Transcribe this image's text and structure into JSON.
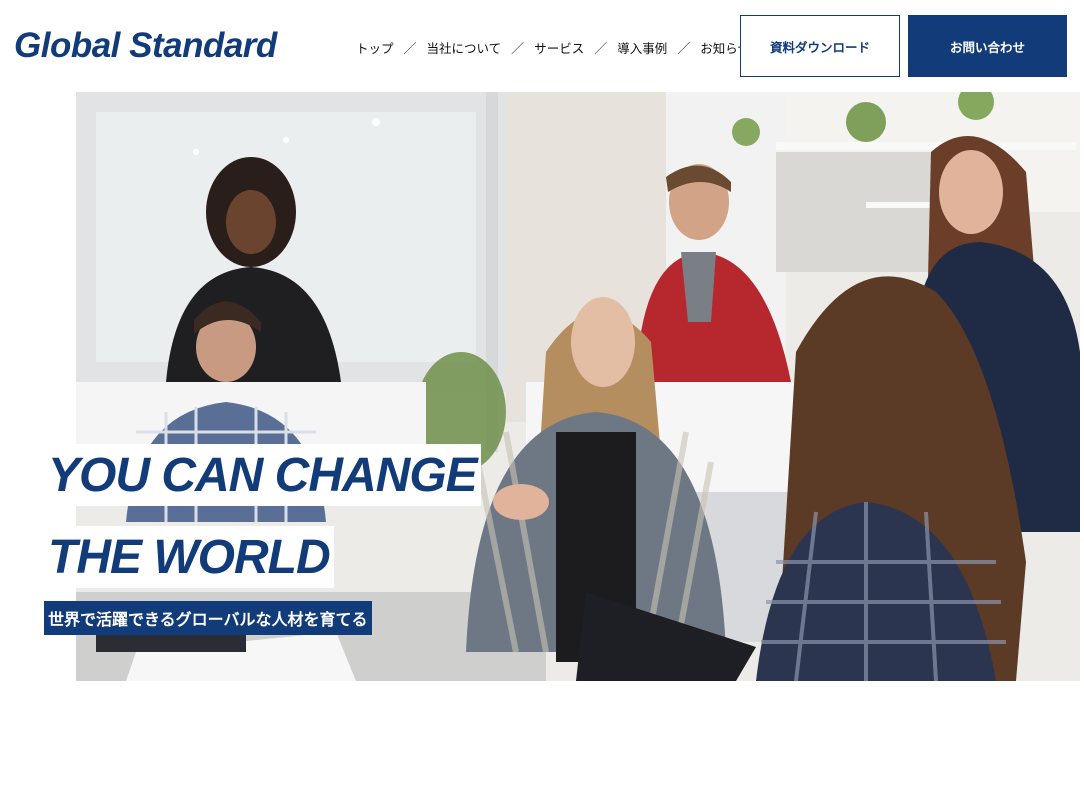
{
  "header": {
    "logo": "Global Standard",
    "nav": [
      {
        "label": "トップ"
      },
      {
        "label": "当社について"
      },
      {
        "label": "サービス"
      },
      {
        "label": "導入事例"
      },
      {
        "label": "お知らせ"
      }
    ],
    "separator": "／",
    "download_button": "資料ダウンロード",
    "contact_button": "お問い合わせ"
  },
  "hero": {
    "headline_line1": "YOU CAN CHANGE",
    "headline_line2": "THE WORLD",
    "subcopy": "世界で活躍できるグローバルな人材を育てる",
    "image_subject": "office-team-meeting-photo"
  },
  "colors": {
    "brand": "#123b7a",
    "background": "#ffffff"
  }
}
